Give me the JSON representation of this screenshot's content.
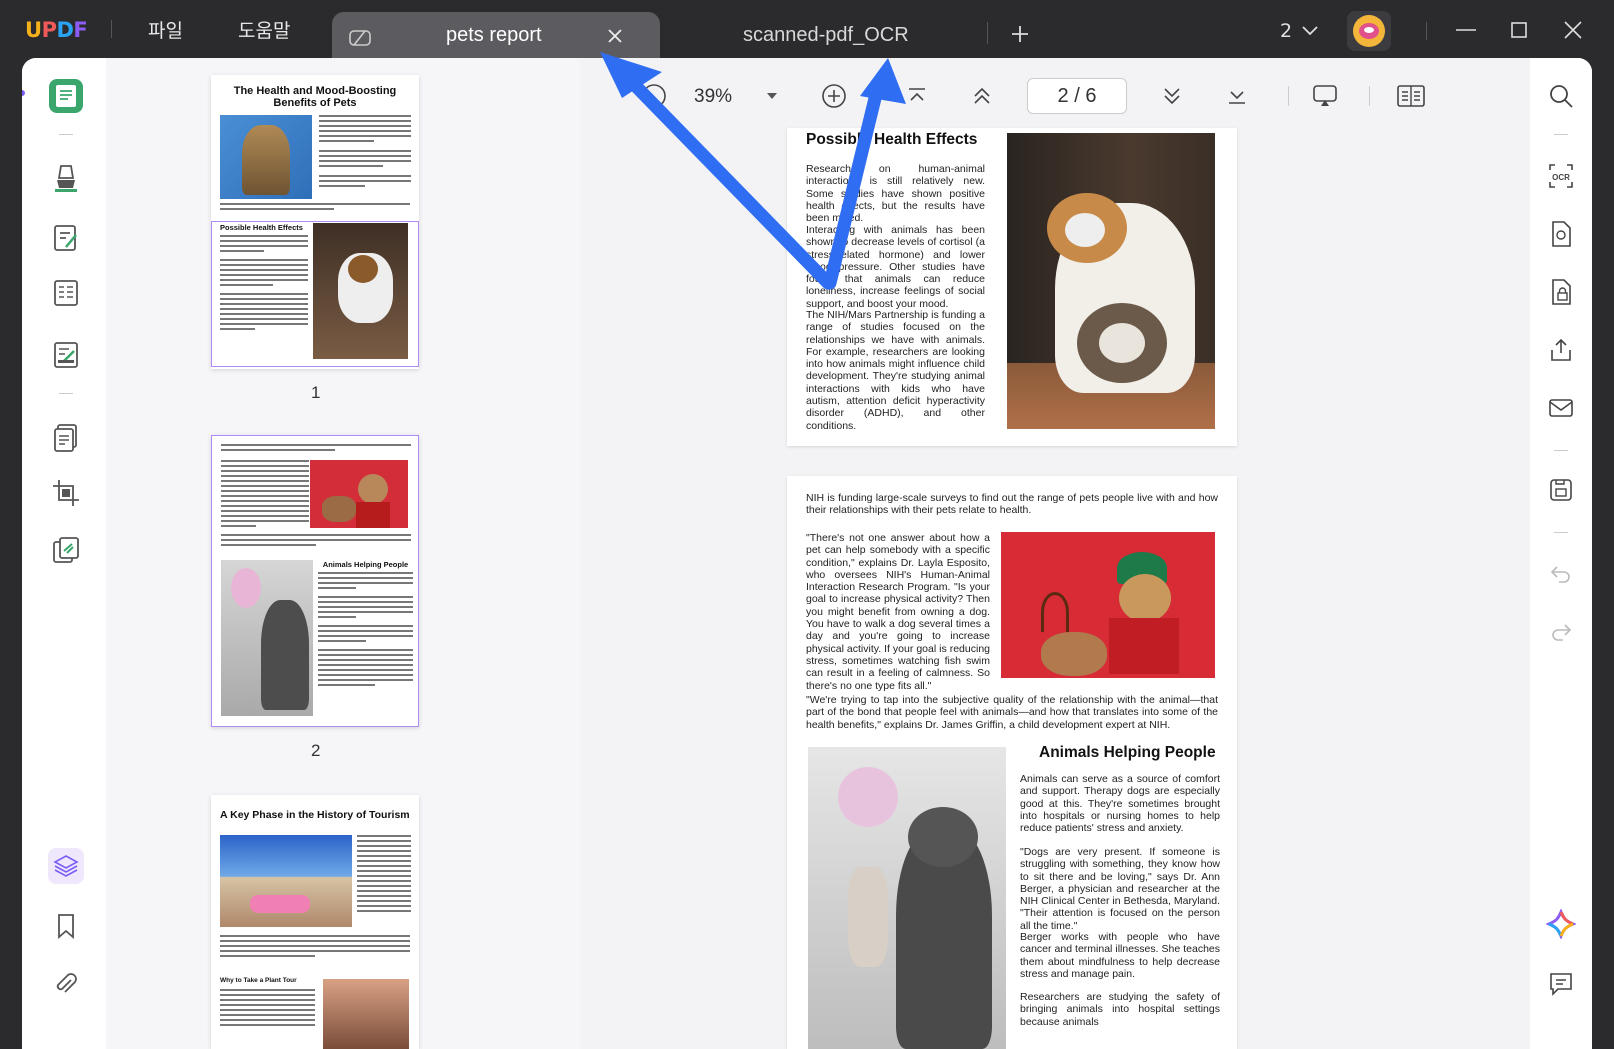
{
  "app": {
    "logo": "UPDF"
  },
  "menu": {
    "file": "파일",
    "help": "도움말"
  },
  "tabs": [
    {
      "title": "pets report"
    },
    {
      "title": "scanned-pdf_OCR"
    }
  ],
  "window": {
    "count": "2"
  },
  "toolbar": {
    "zoom": "39%",
    "page": "2 / 6"
  },
  "thumbnails": [
    {
      "number": "1",
      "title": "The Health and Mood-Boosting Benefits of Pets",
      "section": "Possible Health Effects"
    },
    {
      "number": "2",
      "section": "Animals Helping People"
    },
    {
      "number": "",
      "title": "A Key Phase in the History of Tourism",
      "section": "Why to Take a Plant Tour"
    }
  ],
  "doc": {
    "page1": {
      "heading": "Possible Health Effects",
      "p1": "Research on human-animal interactions is still relatively new. Some studies have shown positive health effects, but the results have been mixed.",
      "p2": "Interacting with animals has been shown to decrease levels of cortisol (a stress-related hormone) and lower blood pressure. Other studies have found that animals can reduce loneliness, increase feelings of social support, and boost your mood.",
      "p3": "The NIH/Mars Partnership is funding a range of studies focused on the relationships we have with animals. For example, researchers are looking into how animals might influence child development. They're studying animal interactions with kids who have autism, attention deficit hyperactivity disorder (ADHD), and other conditions."
    },
    "page2": {
      "intro": "NIH is funding large-scale surveys to find out the range of pets people live with and how their relationships with their pets relate to health.",
      "quote1": "\"There's not one answer about how a pet can help somebody with a specific condition,\" explains Dr. Layla Esposito, who oversees NIH's Human-Animal Interaction Research Program. \"Is your goal to increase physical activity? Then you might benefit from owning a dog. You have to walk a dog several times a day and you're going to increase physical activity. If your goal is reducing stress, sometimes watching fish swim can result in a feeling of calmness. So there's no one type fits all.\"",
      "quote2": "\"We're trying to tap into the subjective quality of the relationship with the animal—that part of the bond that people feel with animals—and how that translates into some of the health benefits,\" explains Dr. James Griffin, a child development expert at NIH.",
      "heading": "Animals Helping People",
      "p4": "Animals can serve as a source of comfort and support. Therapy dogs are especially good at this. They're sometimes brought into hospitals or nursing homes to help reduce patients' stress and anxiety.",
      "p5": "\"Dogs are very present. If someone is struggling with something, they know how to sit there and be loving,\" says Dr. Ann Berger, a physician and researcher at the NIH Clinical Center in Bethesda, Maryland. \"Their attention is focused on the person all the time.\"",
      "p6": "Berger works with people who have cancer and terminal illnesses. She teaches them about mindfulness to help decrease stress and manage pain.",
      "p7": "Researchers are studying the safety of bringing animals into hospital settings because animals"
    }
  },
  "colors": {
    "accent": "#7b5cf5",
    "annotation_arrow": "#2f6df2",
    "titlebar": "#2b2b2e"
  }
}
